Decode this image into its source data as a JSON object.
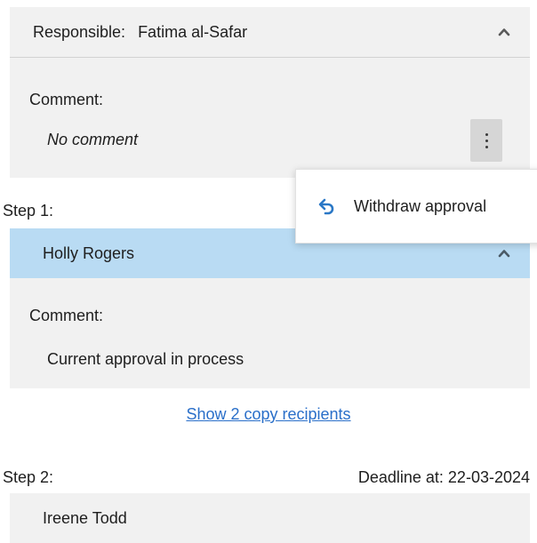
{
  "responsible": {
    "label": "Responsible:",
    "name": "Fatima al-Safar",
    "comment_label": "Comment:",
    "comment_value": "No comment"
  },
  "context_menu": {
    "withdraw_label": "Withdraw approval",
    "icon": "undo-arrow-icon"
  },
  "step1": {
    "label": "Step 1:",
    "approver": "Holly Rogers",
    "comment_label": "Comment:",
    "comment_value": "Current approval in process"
  },
  "copy_recipients_link": "Show 2 copy recipients",
  "step2": {
    "label": "Step 2:",
    "deadline": "Deadline at: 22-03-2024",
    "approver": "Ireene Todd"
  },
  "colors": {
    "panel_bg": "#f1f1f1",
    "selected_header_bg": "#b9dbf3",
    "link": "#2a6fc9",
    "icon_blue": "#2b78c6"
  }
}
